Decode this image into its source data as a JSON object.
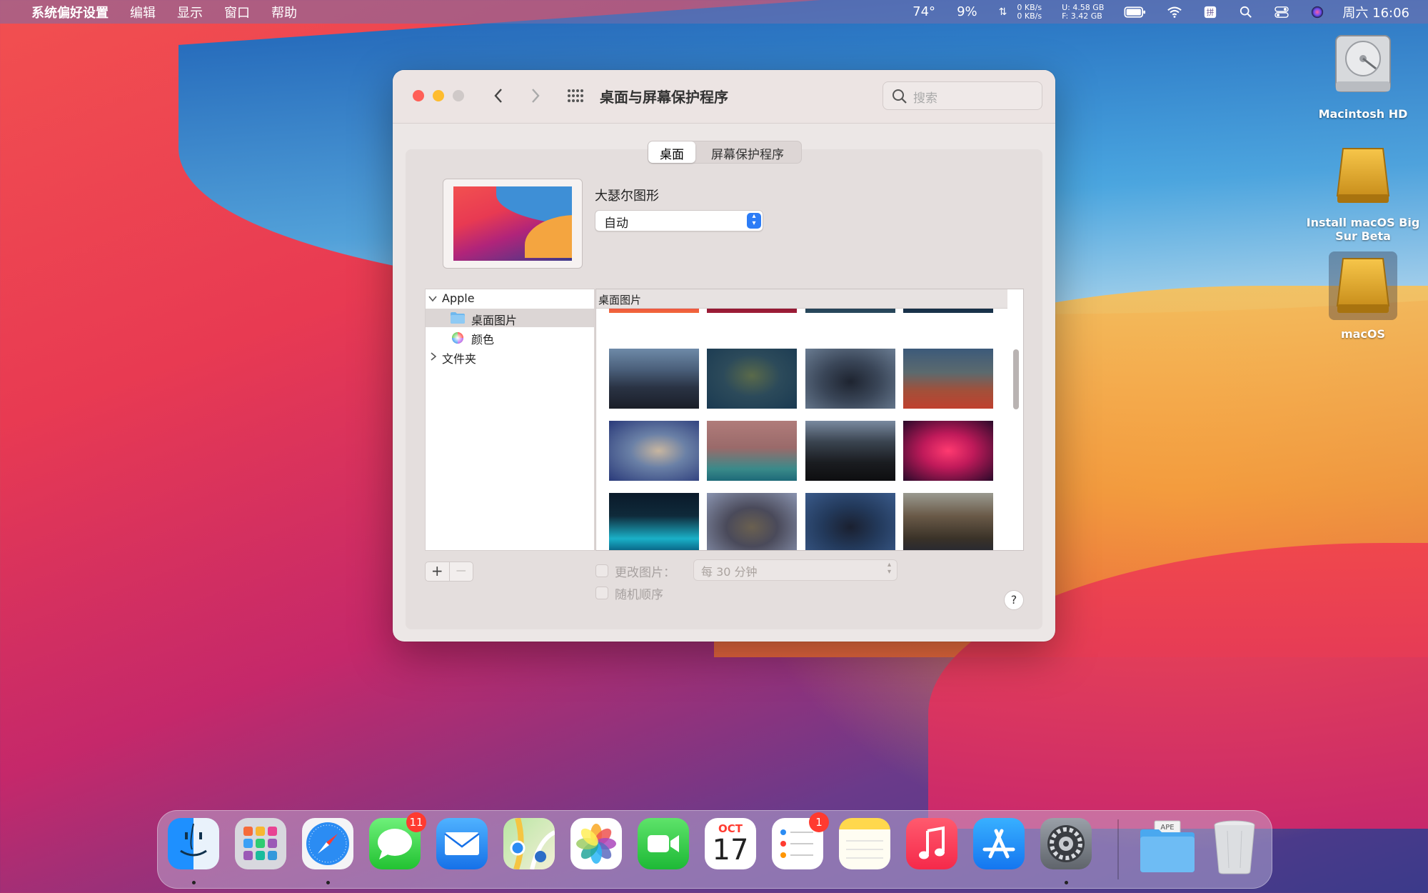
{
  "menubar": {
    "app_name": "系统偏好设置",
    "menus": [
      "编辑",
      "显示",
      "窗口",
      "帮助"
    ],
    "status": {
      "temperature": "74°",
      "cpu": "9%",
      "net_up": "0 KB/s",
      "net_down": "0 KB/s",
      "disk_u": "U:  4.58 GB",
      "disk_f": "F:  3.42 GB",
      "clock": "周六 16:06"
    }
  },
  "desktop": {
    "icons": [
      {
        "label": "Macintosh HD"
      },
      {
        "label": "Install macOS Big Sur Beta"
      },
      {
        "label": "macOS"
      }
    ]
  },
  "window": {
    "title": "桌面与屏幕保护程序",
    "search_placeholder": "搜索",
    "tabs": [
      "桌面",
      "屏幕保护程序"
    ],
    "selected_tab": "桌面",
    "wallpaper_name": "大瑟尔图形",
    "appearance_popup": "自动",
    "source_list": {
      "group": "Apple",
      "items": [
        "桌面图片",
        "颜色"
      ],
      "folder_group": "文件夹"
    },
    "grid_header": "桌面图片",
    "change_picture_label": "更改图片：",
    "change_interval": "每 30 分钟",
    "random_order_label": "随机顺序",
    "add_button": "+",
    "remove_button": "—",
    "help_button": "?"
  },
  "dock": {
    "apps": [
      "Finder",
      "Launchpad",
      "Safari",
      "Messages",
      "Mail",
      "Maps",
      "Photos",
      "FaceTime",
      "Calendar",
      "Reminders",
      "Notes",
      "Music",
      "App Store",
      "System Preferences",
      "Downloads",
      "Trash"
    ],
    "messages_badge": "11",
    "reminders_badge": "1",
    "calendar_month": "OCT",
    "calendar_day": "17"
  },
  "colors": {
    "accent": "#2c7cf6",
    "badge": "#ff3b30",
    "close": "#ff5f57",
    "minimize": "#febc2e"
  }
}
